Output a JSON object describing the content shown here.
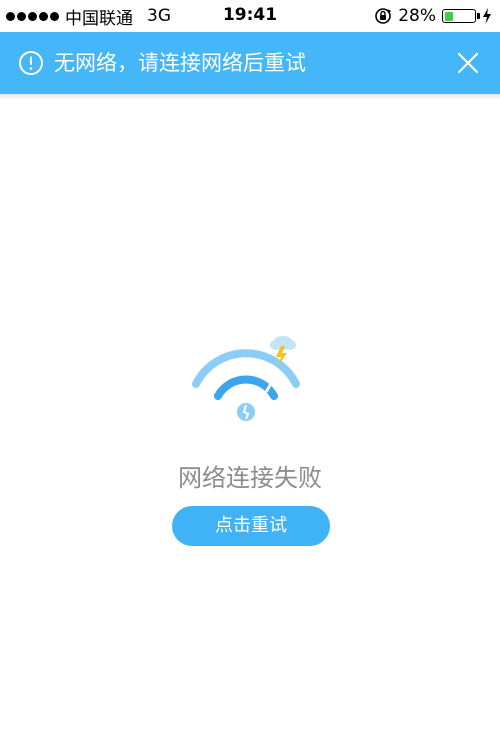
{
  "status_bar": {
    "carrier": "中国联通",
    "network": "3G",
    "time": "19:41",
    "battery_percent": "28%",
    "battery_level": 0.28,
    "battery_color": "#3fd040"
  },
  "banner": {
    "icon": "info-circle-icon",
    "message": "无网络，请连接网络后重试",
    "close_icon": "close-icon",
    "background": "#45b6f7"
  },
  "main": {
    "illustration": "wifi-broken-icon",
    "error_message": "网络连接失败",
    "retry_label": "点击重试",
    "accent": "#3fb3f5"
  }
}
